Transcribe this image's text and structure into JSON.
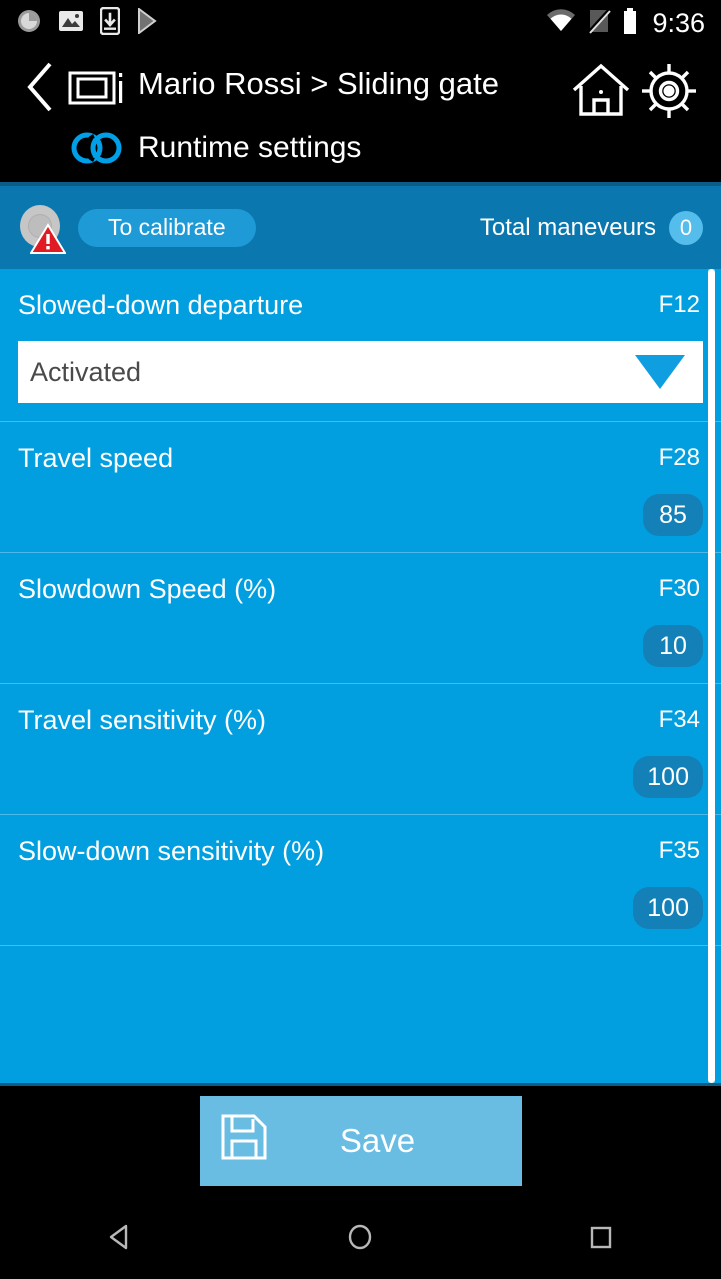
{
  "colors": {
    "band_blue": "#0a78ae",
    "list_blue": "#029fe0",
    "pill_blue": "#1e9ad6",
    "badge_blue": "#1380b8",
    "save_blue": "#69bde3",
    "accent_cyan": "#00a0e9",
    "warning_red": "#e01b24",
    "black": "#000000"
  },
  "statusbar": {
    "clock": "9:36",
    "left_icons": [
      "sync-spinner-icon",
      "photo-icon",
      "app-download-icon",
      "play-store-icon"
    ],
    "right_icons": [
      "wifi-icon",
      "no-sim-icon",
      "battery-icon"
    ]
  },
  "header": {
    "back_icon": "chevron-left-icon",
    "device_icon": "device-info-icon",
    "title": "Mario Rossi > Sliding gate",
    "home_icon": "home-icon",
    "gear_icon": "gear-icon",
    "link_icon": "connection-link-icon",
    "subtitle": "Runtime settings"
  },
  "statusband": {
    "calibration_icon": "calibration-warning-icon",
    "calibrate_label": "To calibrate",
    "maneuvers_label": "Total maneveurs",
    "maneuvers_count": "0"
  },
  "settings": [
    {
      "label": "Slowed-down departure",
      "code": "F12",
      "type": "select",
      "value": "Activated"
    },
    {
      "label": "Travel speed",
      "code": "F28",
      "type": "number",
      "value": "85"
    },
    {
      "label": "Slowdown Speed (%)",
      "code": "F30",
      "type": "number",
      "value": "10"
    },
    {
      "label": "Travel sensitivity (%)",
      "code": "F34",
      "type": "number",
      "value": "100"
    },
    {
      "label": "Slow-down sensitivity (%)",
      "code": "F35",
      "type": "number",
      "value": "100"
    }
  ],
  "footer": {
    "save_label": "Save",
    "save_icon": "floppy-disk-icon"
  },
  "navbar": {
    "back_icon": "android-back-icon",
    "home_icon": "android-home-icon",
    "recents_icon": "android-recents-icon"
  }
}
